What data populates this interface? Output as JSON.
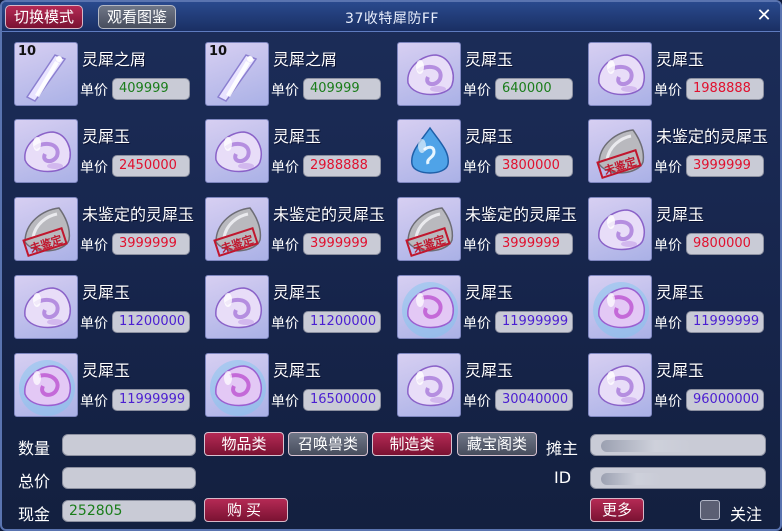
{
  "toolbar": {
    "switch_mode_label": "切换模式",
    "view_catalog_label": "观看图鉴",
    "title": "37收特犀防FF",
    "close_label": "✕"
  },
  "price_label": "单价",
  "items": [
    {
      "name": "灵犀之屑",
      "qty": "10",
      "price": "409999",
      "price_color": "green",
      "icon": "shard"
    },
    {
      "name": "灵犀之屑",
      "qty": "10",
      "price": "409999",
      "price_color": "green",
      "icon": "shard"
    },
    {
      "name": "灵犀玉",
      "qty": "",
      "price": "640000",
      "price_color": "green",
      "icon": "jade-purple"
    },
    {
      "name": "灵犀玉",
      "qty": "",
      "price": "1988888",
      "price_color": "red",
      "icon": "jade-purple"
    },
    {
      "name": "灵犀玉",
      "qty": "",
      "price": "2450000",
      "price_color": "red",
      "icon": "jade-purple"
    },
    {
      "name": "灵犀玉",
      "qty": "",
      "price": "2988888",
      "price_color": "red",
      "icon": "jade-purple"
    },
    {
      "name": "灵犀玉",
      "qty": "",
      "price": "3800000",
      "price_color": "red",
      "icon": "jade-blue"
    },
    {
      "name": "未鉴定的灵犀玉",
      "qty": "",
      "price": "3999999",
      "price_color": "red",
      "icon": "unidentified"
    },
    {
      "name": "未鉴定的灵犀玉",
      "qty": "",
      "price": "3999999",
      "price_color": "red",
      "icon": "unidentified"
    },
    {
      "name": "未鉴定的灵犀玉",
      "qty": "",
      "price": "3999999",
      "price_color": "red",
      "icon": "unidentified"
    },
    {
      "name": "未鉴定的灵犀玉",
      "qty": "",
      "price": "3999999",
      "price_color": "red",
      "icon": "unidentified"
    },
    {
      "name": "灵犀玉",
      "qty": "",
      "price": "9800000",
      "price_color": "red",
      "icon": "jade-purple"
    },
    {
      "name": "灵犀玉",
      "qty": "",
      "price": "11200000",
      "price_color": "purple",
      "icon": "jade-purple"
    },
    {
      "name": "灵犀玉",
      "qty": "",
      "price": "11200000",
      "price_color": "purple",
      "icon": "jade-purple"
    },
    {
      "name": "灵犀玉",
      "qty": "",
      "price": "11999999",
      "price_color": "purple",
      "icon": "jade-glow"
    },
    {
      "name": "灵犀玉",
      "qty": "",
      "price": "11999999",
      "price_color": "purple",
      "icon": "jade-glow"
    },
    {
      "name": "灵犀玉",
      "qty": "",
      "price": "11999999",
      "price_color": "purple",
      "icon": "jade-glow"
    },
    {
      "name": "灵犀玉",
      "qty": "",
      "price": "16500000",
      "price_color": "purple",
      "icon": "jade-glow"
    },
    {
      "name": "灵犀玉",
      "qty": "",
      "price": "30040000",
      "price_color": "purple",
      "icon": "jade-purple"
    },
    {
      "name": "灵犀玉",
      "qty": "",
      "price": "96000000",
      "price_color": "purple",
      "icon": "jade-purple"
    }
  ],
  "colors": {
    "green": "#1a7d1a",
    "red": "#e0102e",
    "purple": "#4b1fd1",
    "accent_red": "#b52a55"
  },
  "bottom": {
    "quantity_label": "数量",
    "quantity_value": "",
    "total_label": "总价",
    "total_value": "",
    "cash_label": "现金",
    "cash_value": "252805",
    "buy_label": "购买",
    "categories": [
      "物品类",
      "召唤兽类",
      "制造类",
      "藏宝阁类"
    ],
    "active_category": "物品类",
    "owner_label": "摊主",
    "id_label": "ID",
    "more_label": "更多",
    "follow_label": "关注"
  },
  "unidentified_stamp": "未鉴定"
}
